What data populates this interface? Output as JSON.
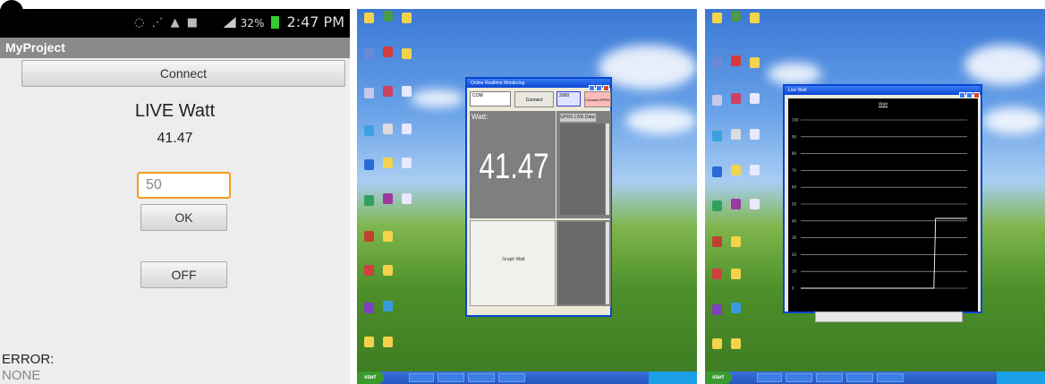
{
  "android": {
    "status_time": "2:47 PM",
    "battery_percent": "32%",
    "app_title": "MyProject",
    "connect_label": "Connect",
    "live_title": "LIVE Watt",
    "live_value": "41.47",
    "input_value": "50",
    "ok_label": "OK",
    "off_label": "OFF",
    "error_label": "ERROR:",
    "error_value": "NONE"
  },
  "desktop_monitor": {
    "window_title": "Online Realtime Monitoring",
    "port_value": "COM",
    "connect_label": "Connect",
    "baud_value": "2000",
    "gprs_button_label": "Connect GPRS",
    "watt_label": "Watt:",
    "watt_value": "41.47",
    "gprs_live_label": "GPRS LIVE Data:",
    "graph_label": "Graph Watt",
    "start_label": "start"
  },
  "desktop_chart": {
    "window_title": "Live Watt",
    "start_label": "start"
  },
  "chart_data": {
    "type": "line",
    "title": "Watt",
    "xlabel": "",
    "ylabel": "",
    "y_ticks": [
      "100",
      "90",
      "80",
      "70",
      "60",
      "50",
      "40",
      "30",
      "20",
      "10",
      "0"
    ],
    "ylim": [
      0,
      100
    ],
    "grid": true,
    "series": [
      {
        "values_x": [
          0,
          80,
          81,
          100
        ],
        "values_y": [
          0,
          0,
          41.47,
          41.47
        ]
      }
    ],
    "colors": {
      "background": "#000000",
      "grid": "#bbbbbb",
      "line": "#ffffff"
    }
  }
}
